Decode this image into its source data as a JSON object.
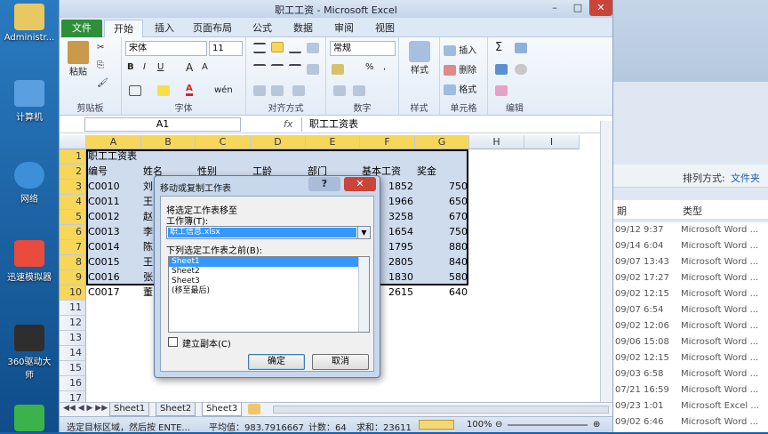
{
  "desktop": {
    "icons": [
      {
        "label": "Administr..."
      },
      {
        "label": "计算机"
      },
      {
        "label": "网络"
      },
      {
        "label": "迅速模拟器"
      },
      {
        "label": "360驱动大师"
      }
    ]
  },
  "window": {
    "title": "职工工资 - Microsoft Excel",
    "minimize": "–",
    "maximize": "□",
    "close": "✕"
  },
  "tabs": [
    "文件",
    "开始",
    "插入",
    "页面布局",
    "公式",
    "数据",
    "审阅",
    "视图"
  ],
  "ribbon": {
    "clipboard": {
      "label": "剪贴板",
      "paste": "粘贴"
    },
    "font": {
      "label": "字体",
      "name": "宋体",
      "size": "11",
      "bold": "B",
      "italic": "I",
      "underline": "U",
      "grow": "A",
      "shrink": "A",
      "wen": "wén"
    },
    "alignment": {
      "label": "对齐方式"
    },
    "number": {
      "label": "数字",
      "format": "常规",
      "percent": "%",
      "comma": ","
    },
    "styles": {
      "label": "样式",
      "btn": "样式"
    },
    "cells": {
      "label": "单元格",
      "insert": "插入",
      "delete": "删除",
      "format": "格式"
    },
    "editing": {
      "label": "编辑",
      "sigma": "Σ"
    }
  },
  "formula_bar": {
    "name_box": "A1",
    "fx": "fx",
    "content": "职工工资表"
  },
  "columns": [
    "A",
    "B",
    "C",
    "D",
    "E",
    "F",
    "G",
    "H",
    "I"
  ],
  "rows": [
    "1",
    "2",
    "3",
    "4",
    "5",
    "6",
    "7",
    "8",
    "9",
    "10",
    "11",
    "12",
    "13",
    "14",
    "15",
    "16",
    "17"
  ],
  "cells": {
    "a1": "职工工资表",
    "header": [
      "编号",
      "姓名",
      "性别",
      "工龄",
      "部门",
      "基本工资",
      "奖金"
    ],
    "ids": [
      "C0010",
      "C0011",
      "C0012",
      "C0013",
      "C0014",
      "C0015",
      "C0016",
      "C0017"
    ],
    "names": [
      "刘",
      "王",
      "赵",
      "李",
      "陈",
      "王",
      "张",
      "董"
    ],
    "salary": [
      "1852",
      "1966",
      "3258",
      "1654",
      "1795",
      "2805",
      "1830",
      "2615"
    ],
    "bonus": [
      "750",
      "650",
      "670",
      "750",
      "880",
      "840",
      "580",
      "640"
    ]
  },
  "sheets": [
    "Sheet1",
    "Sheet2",
    "Sheet3"
  ],
  "status": {
    "mode": "选定目标区域，然后按 ENTE...",
    "average": "平均值：983.7916667",
    "count": "计数：64",
    "sum": "求和：23611",
    "zoom": "100%",
    "minus": "⊖",
    "plus": "⊕"
  },
  "dialog": {
    "title": "移动或复制工作表",
    "help": "?",
    "close": "✕",
    "move_to": "将选定工作表移至",
    "workbook_label": "工作簿(T):",
    "workbook_value": "职工信息.xlsx",
    "before_label": "下列选定工作表之前(B):",
    "list": [
      "Sheet1",
      "Sheet2",
      "Sheet3",
      "(移至最后)"
    ],
    "copy_label": "建立副本(C)",
    "ok": "确定",
    "cancel": "取消"
  },
  "explorer": {
    "sort_label": "排列方式:",
    "sort_value": "文件夹",
    "col_date": "期",
    "col_type": "类型",
    "rows": [
      {
        "date": "09/12 9:37",
        "type": "Microsoft Word ..."
      },
      {
        "date": "09/14 6:04",
        "type": "Microsoft Word ..."
      },
      {
        "date": "09/07 13:43",
        "type": "Microsoft Word ..."
      },
      {
        "date": "09/02 17:27",
        "type": "Microsoft Word ..."
      },
      {
        "date": "09/02 12:15",
        "type": "Microsoft Word ..."
      },
      {
        "date": "09/07 6:54",
        "type": "Microsoft Word ..."
      },
      {
        "date": "09/02 12:06",
        "type": "Microsoft Word ..."
      },
      {
        "date": "09/06 15:08",
        "type": "Microsoft Word ..."
      },
      {
        "date": "09/02 12:15",
        "type": "Microsoft Word ..."
      },
      {
        "date": "09/03 6:58",
        "type": "Microsoft Word ..."
      },
      {
        "date": "07/21 16:59",
        "type": "Microsoft Word ..."
      },
      {
        "date": "09/23 1:01",
        "type": "Microsoft Excel ..."
      },
      {
        "date": "09/02 6:46",
        "type": "Microsoft Word ..."
      }
    ]
  }
}
